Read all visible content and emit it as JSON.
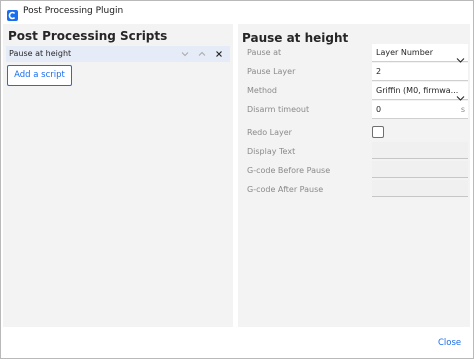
{
  "window": {
    "title": "Post Processing Plugin",
    "accent_color": "#196ef0"
  },
  "left": {
    "heading": "Post Processing Scripts",
    "scripts": [
      {
        "label": "Pause at height",
        "selected": true
      }
    ],
    "add_button_label": "Add a script"
  },
  "right": {
    "heading": "Pause at height",
    "fields": {
      "pause_at": {
        "label": "Pause at",
        "value": "Layer Number",
        "type": "dropdown"
      },
      "pause_layer": {
        "label": "Pause Layer",
        "value": "2",
        "type": "text"
      },
      "method": {
        "label": "Method",
        "value": "Griffin (M0, firmwa...",
        "type": "dropdown"
      },
      "disarm_timeout": {
        "label": "Disarm timeout",
        "value": "0",
        "unit": "s",
        "type": "number"
      },
      "redo_layer": {
        "label": "Redo Layer",
        "checked": false,
        "type": "checkbox"
      },
      "display_text": {
        "label": "Display Text",
        "value": "",
        "type": "text"
      },
      "gcode_before": {
        "label": "G-code Before Pause",
        "value": "",
        "type": "text"
      },
      "gcode_after": {
        "label": "G-code After Pause",
        "value": "",
        "type": "text"
      }
    }
  },
  "footer": {
    "close_label": "Close"
  }
}
